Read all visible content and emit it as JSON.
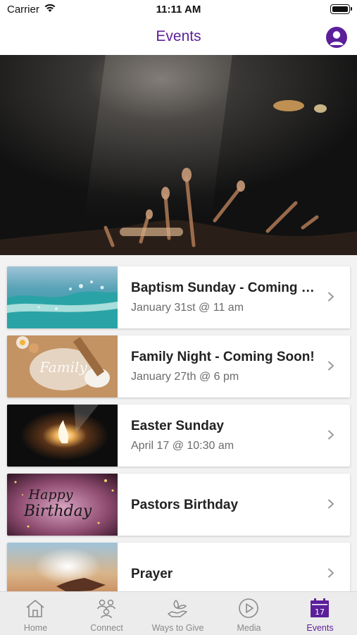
{
  "status_bar": {
    "carrier": "Carrier",
    "time": "11:11 AM"
  },
  "header": {
    "title": "Events"
  },
  "events": [
    {
      "title": "Baptism Sunday - Coming Soon!",
      "subtitle": "January 31st @ 11 am"
    },
    {
      "title": "Family Night - Coming Soon!",
      "subtitle": "January 27th @ 6 pm"
    },
    {
      "title": "Easter Sunday",
      "subtitle": "April 17 @ 10:30 am"
    },
    {
      "title": "Pastors Birthday",
      "subtitle": ""
    },
    {
      "title": "Prayer",
      "subtitle": ""
    }
  ],
  "thumb_texts": {
    "family": "Family",
    "happy": "Happy",
    "birthday": "Birthday"
  },
  "tabs": [
    {
      "label": "Home",
      "icon": "home-icon"
    },
    {
      "label": "Connect",
      "icon": "connect-icon"
    },
    {
      "label": "Ways to Give",
      "icon": "give-icon"
    },
    {
      "label": "Media",
      "icon": "play-icon"
    },
    {
      "label": "Events",
      "icon": "calendar-icon",
      "badge": "17",
      "active": true
    }
  ],
  "colors": {
    "accent": "#5b1f9a",
    "inactive": "#8a8a8a"
  }
}
